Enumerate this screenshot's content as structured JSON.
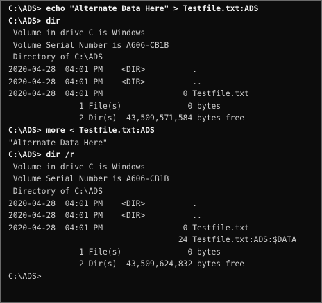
{
  "terminal": {
    "lines": [
      {
        "text": "C:\\ADS> echo \"Alternate Data Here\" > Testfile.txt:ADS",
        "kind": "cmd"
      },
      {
        "text": "C:\\ADS> dir",
        "kind": "cmd"
      },
      {
        "text": " Volume in drive C is Windows",
        "kind": "out"
      },
      {
        "text": " Volume Serial Number is A606-CB1B",
        "kind": "out"
      },
      {
        "text": " Directory of C:\\ADS",
        "kind": "out"
      },
      {
        "text": "2020-04-28  04:01 PM    <DIR>          .",
        "kind": "out"
      },
      {
        "text": "2020-04-28  04:01 PM    <DIR>          ..",
        "kind": "out"
      },
      {
        "text": "2020-04-28  04:01 PM                 0 Testfile.txt",
        "kind": "out"
      },
      {
        "text": "               1 File(s)              0 bytes",
        "kind": "out"
      },
      {
        "text": "               2 Dir(s)  43,509,571,584 bytes free",
        "kind": "out"
      },
      {
        "text": "C:\\ADS> more < Testfile.txt:ADS",
        "kind": "cmd"
      },
      {
        "text": "\"Alternate Data Here\"",
        "kind": "out"
      },
      {
        "text": "C:\\ADS> dir /r",
        "kind": "cmd"
      },
      {
        "text": " Volume in drive C is Windows",
        "kind": "out"
      },
      {
        "text": " Volume Serial Number is A606-CB1B",
        "kind": "out"
      },
      {
        "text": " Directory of C:\\ADS",
        "kind": "out"
      },
      {
        "text": "2020-04-28  04:01 PM    <DIR>          .",
        "kind": "out"
      },
      {
        "text": "2020-04-28  04:01 PM    <DIR>          ..",
        "kind": "out"
      },
      {
        "text": "2020-04-28  04:01 PM                 0 Testfile.txt",
        "kind": "out"
      },
      {
        "text": "                                    24 Testfile.txt:ADS:$DATA",
        "kind": "out"
      },
      {
        "text": "               1 File(s)              0 bytes",
        "kind": "out"
      },
      {
        "text": "               2 Dir(s)  43,509,624,832 bytes free",
        "kind": "out"
      },
      {
        "text": "C:\\ADS>",
        "kind": "out"
      }
    ]
  },
  "colors": {
    "background": "#0c0c0c",
    "text": "#cfcfcf",
    "command": "#f2f2f2"
  }
}
